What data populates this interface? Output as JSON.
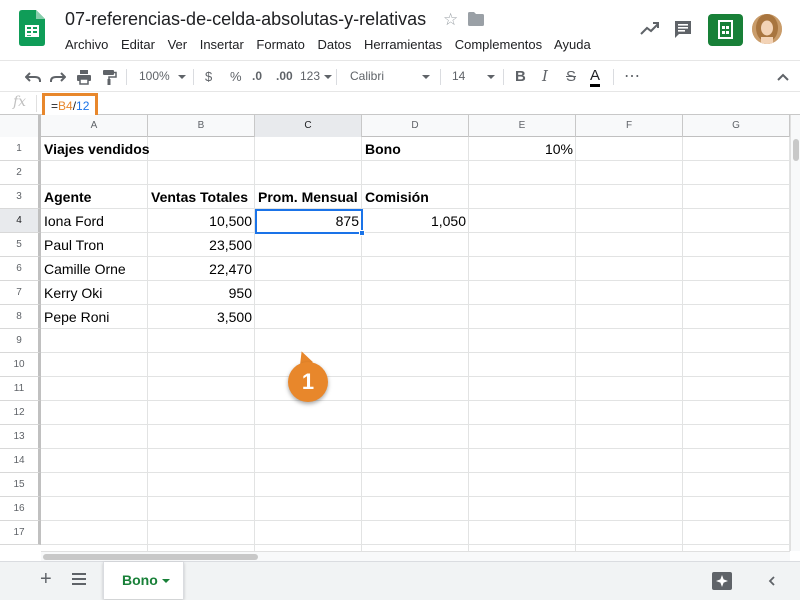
{
  "app": {
    "doc_title": "07-referencias-de-celda-absolutas-y-relativas",
    "menu": [
      "Archivo",
      "Editar",
      "Ver",
      "Insertar",
      "Formato",
      "Datos",
      "Herramientas",
      "Complementos",
      "Ayuda"
    ],
    "colors": {
      "brand_green": "#188038",
      "accent_orange": "#e8872b",
      "selection_blue": "#1a73e8"
    }
  },
  "toolbar": {
    "zoom": "100%",
    "currency": "$",
    "percent": "%",
    "decrease_decimals": ".0",
    "increase_decimals": ".00",
    "more_formats": "123",
    "font": "Calibri",
    "font_size": "14",
    "bold": "B",
    "italic": "I",
    "strikethrough": "S",
    "text_color": "A",
    "more": "⋯",
    "collapse": "^"
  },
  "formula_bar": {
    "fx_label": "fx",
    "formula_eq": "=",
    "formula_ref": "B4",
    "formula_rest_sep": "/",
    "formula_rest_num": "12"
  },
  "grid": {
    "columns": [
      "A",
      "B",
      "C",
      "D",
      "E",
      "F",
      "G"
    ],
    "rows": [
      "1",
      "2",
      "3",
      "4",
      "5",
      "6",
      "7",
      "8",
      "9",
      "10",
      "11",
      "12",
      "13",
      "14",
      "15",
      "16",
      "17"
    ],
    "cells": {
      "A1": "Viajes vendidos",
      "D1": "Bono",
      "E1": "10%",
      "A3": "Agente",
      "B3": "Ventas Totales",
      "C3": "Prom. Mensual",
      "D3": "Comisión",
      "A4": "Iona Ford",
      "B4": "10,500",
      "C4": "875",
      "D4": "1,050",
      "A5": "Paul Tron",
      "B5": "23,500",
      "A6": "Camille Orne",
      "B6": "22,470",
      "A7": "Kerry Oki",
      "B7": "950",
      "A8": "Pepe Roni",
      "B8": "3,500"
    },
    "active_cell": "C4"
  },
  "callout": {
    "number": "1"
  },
  "sheets": {
    "tabs": [
      {
        "label": "Bono",
        "active": true
      }
    ],
    "add_label": "+"
  }
}
